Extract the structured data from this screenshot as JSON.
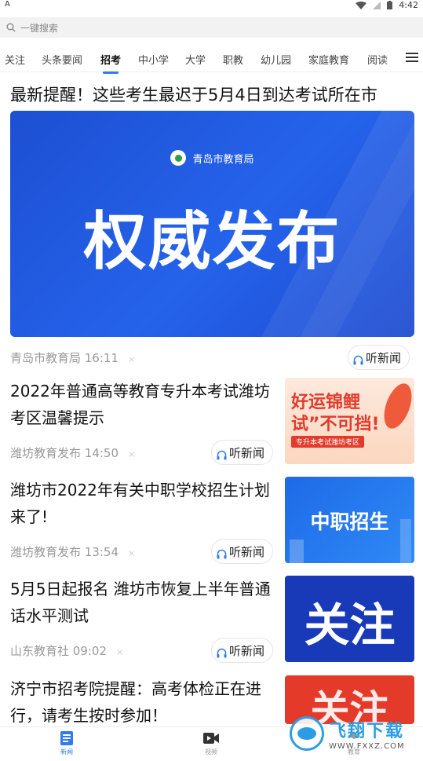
{
  "status_bar": {
    "left_glyph": "A",
    "time": "4:42",
    "icons": [
      "wifi-icon",
      "signal-icon",
      "battery-icon"
    ]
  },
  "search": {
    "placeholder": "一键搜索",
    "icon": "search-icon"
  },
  "tabs": {
    "items": [
      "关注",
      "头条要闻",
      "招考",
      "中小学",
      "大学",
      "职教",
      "幼儿园",
      "家庭教育",
      "阅读"
    ],
    "active": "招考",
    "menu_icon": "menu-icon"
  },
  "lead_article": {
    "headline": "最新提醒！这些考生最迟于5月4日到达考试所在市",
    "image": {
      "org": "青岛市教育局",
      "big_text": "权威发布"
    },
    "source": "青岛市教育局 16:11",
    "close_glyph": "×",
    "listen_label": "听新闻"
  },
  "articles": [
    {
      "title": "2022年普通高等教育专升本考试潍坊考区温馨提示",
      "source": "潍坊教育发布 14:50",
      "listen_label": "听新闻",
      "thumb_text": "好运锦鲤\n试”不可挡!",
      "thumb_strip": "专升本考试潍坊考区"
    },
    {
      "title": "潍坊市2022年有关中职学校招生计划来了!",
      "source": "潍坊教育发布 13:54",
      "listen_label": "听新闻",
      "thumb_text": "中职招生"
    },
    {
      "title": "5月5日起报名 潍坊市恢复上半年普通话水平测试",
      "source": "山东教育社 09:02",
      "listen_label": "听新闻",
      "thumb_text": "关注"
    },
    {
      "title": "济宁市招考院提醒：高考体检正在进行，请考生按时参加！",
      "thumb_text": "关注"
    }
  ],
  "bottom_nav": {
    "items": [
      {
        "label": "新闻",
        "icon": "news-icon",
        "active": true
      },
      {
        "label": "视频",
        "icon": "video-icon",
        "active": false
      },
      {
        "label": "教育",
        "icon": "education-icon",
        "active": false
      }
    ]
  },
  "watermark": {
    "name": "飞翔下载",
    "url": "WWW.FXXZ.COM"
  },
  "colors": {
    "accent": "#2f7bef",
    "hero_blue": "#2563eb",
    "thumb_red": "#e23b2c"
  }
}
